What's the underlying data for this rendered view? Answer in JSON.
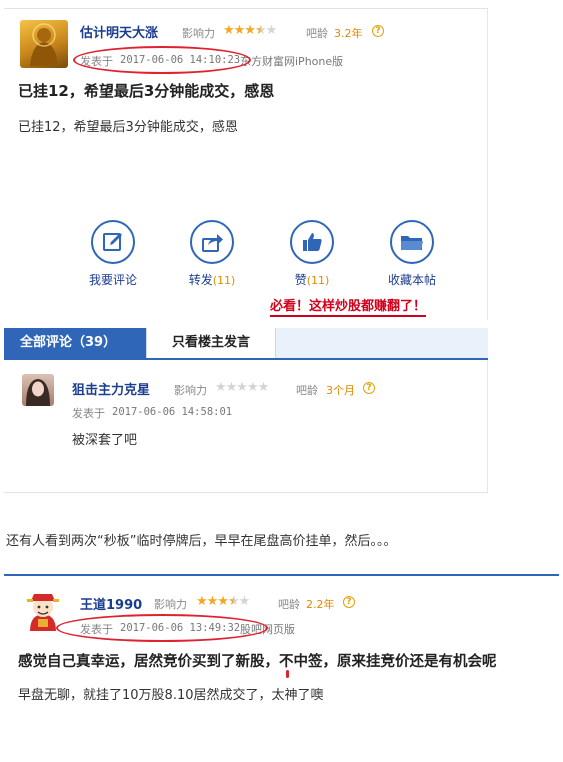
{
  "post1": {
    "username": "估计明天大涨",
    "influence_label": "影响力",
    "influence_stars": 3.5,
    "age_label": "吧龄",
    "age_value": "3.2年",
    "posted_prefix": "发表于",
    "posted_time": "2017-06-06 14:10:23",
    "source": "东方财富网iPhone版",
    "title": "已挂12，希望最后3分钟能成交，感恩",
    "body": "已挂12，希望最后3分钟能成交，感恩"
  },
  "actions": [
    {
      "label": "我要评论",
      "count": "",
      "icon": "edit-icon"
    },
    {
      "label": "转发",
      "count": "(11)",
      "icon": "share-icon"
    },
    {
      "label": "赞",
      "count": "(11)",
      "icon": "thumbs-up-icon"
    },
    {
      "label": "收藏本帖",
      "count": "",
      "icon": "folder-icon"
    }
  ],
  "promo_link": "必看！这样炒股都赚翻了！",
  "tabs": {
    "all_comments": "全部评论（39）",
    "owner_only": "只看楼主发言"
  },
  "comment1": {
    "username": "狙击主力克星",
    "influence_label": "影响力",
    "influence_stars": 0,
    "age_label": "吧龄",
    "age_value": "3个月",
    "posted_prefix": "发表于",
    "posted_time": "2017-06-06 14:58:01",
    "body": "被深套了吧"
  },
  "separator_text": "还有人看到两次“秒板”临时停牌后，早早在尾盘高价挂单，然后。。。",
  "post2": {
    "username": "王道1990",
    "influence_label": "影响力",
    "influence_stars": 3.5,
    "age_label": "吧龄",
    "age_value": "2.2年",
    "posted_prefix": "发表于",
    "posted_time": "2017-06-06 13:49:32",
    "source": "股吧网页版",
    "title": "感觉自己真幸运，居然竞价买到了新股，不中签，原来挂竞价还是有机会呢",
    "body": "早盘无聊，就挂了10万股8.10居然成交了，太神了噢"
  },
  "colors": {
    "link_blue": "#1a3d8f",
    "accent_blue": "#2f66b8",
    "star_gold": "#f5a623",
    "annotation_red": "#e0212f"
  }
}
